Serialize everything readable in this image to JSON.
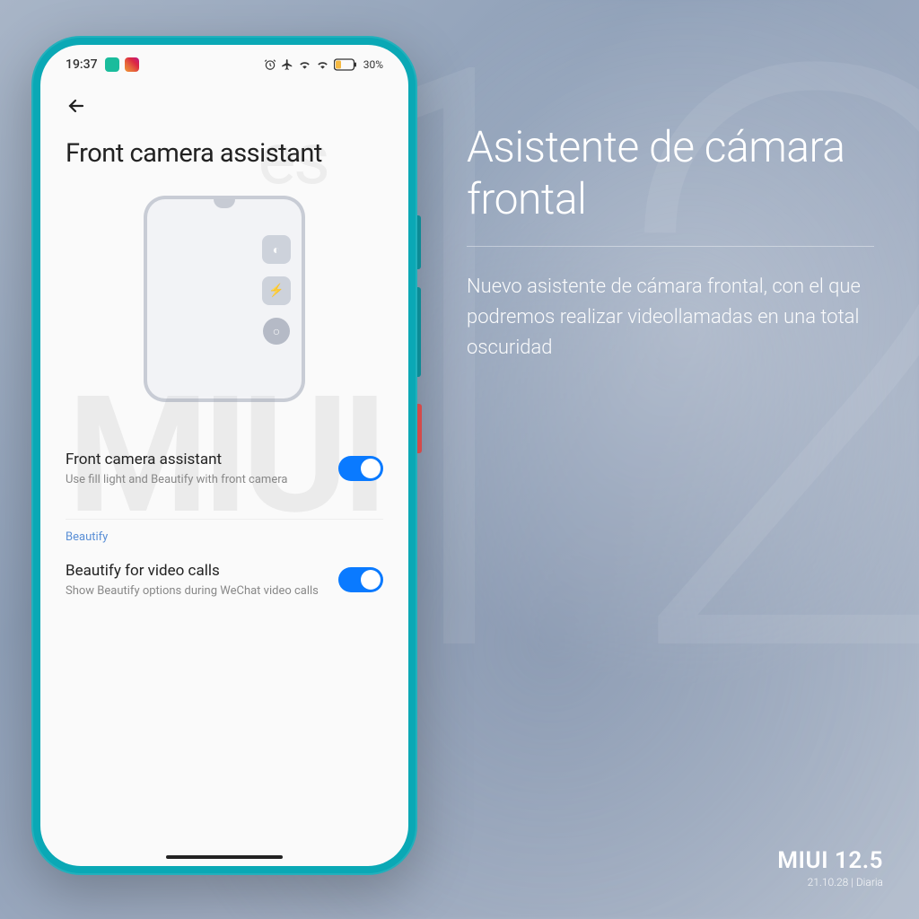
{
  "promo": {
    "title": "Asistente de cámara frontal",
    "description": "Nuevo asistente de cámara frontal, con el que podremos realizar videollamadas en una total oscuridad"
  },
  "footer": {
    "brand": "MIUI 12.5",
    "build": "21.10.28 | Diaria"
  },
  "status_bar": {
    "time": "19:37",
    "battery_percent": "30%"
  },
  "page": {
    "title": "Front camera assistant"
  },
  "settings": {
    "main": {
      "title": "Front camera assistant",
      "desc": "Use fill light and Beautify with front camera",
      "enabled": true
    },
    "section_label": "Beautify",
    "beautify": {
      "title": "Beautify for video calls",
      "desc": "Show Beautify options during WeChat video calls",
      "enabled": true
    }
  },
  "watermark": "MIUIes"
}
